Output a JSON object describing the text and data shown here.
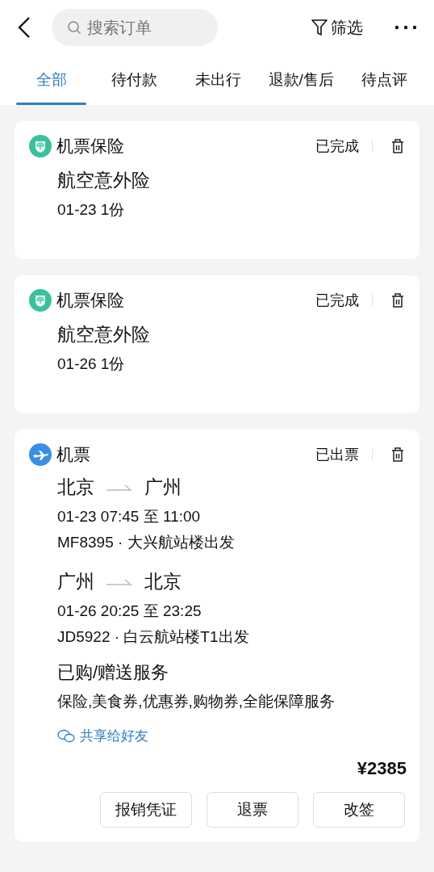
{
  "search": {
    "placeholder": "搜索订单"
  },
  "filter": "筛选",
  "tabs": [
    {
      "label": "全部",
      "selected": true
    },
    {
      "label": "待付款",
      "selected": false
    },
    {
      "label": "未出行",
      "selected": false
    },
    {
      "label": "退款/售后",
      "selected": false
    },
    {
      "label": "待点评",
      "selected": false
    }
  ],
  "orders": [
    {
      "kind": "insurance",
      "category": "机票保险",
      "status": "已完成",
      "product": "航空意外险",
      "detail": "01-23 1份"
    },
    {
      "kind": "insurance",
      "category": "机票保险",
      "status": "已完成",
      "product": "航空意外险",
      "detail": "01-26 1份"
    },
    {
      "kind": "flight",
      "category": "机票",
      "status": "已出票",
      "legs": [
        {
          "from": "北京",
          "to": "广州",
          "time": "01-23 07:45 至 11:00",
          "flight": "MF8395 · 大兴航站楼出发"
        },
        {
          "from": "广州",
          "to": "北京",
          "time": "01-26 20:25 至 23:25",
          "flight": "JD5922 · 白云航站楼T1出发"
        }
      ],
      "services_title": "已购/赠送服务",
      "services": "保险,美食券,优惠券,购物券,全能保障服务",
      "share": "共享给好友",
      "price": "¥2385",
      "buttons": [
        "报销凭证",
        "退票",
        "改签"
      ]
    }
  ]
}
